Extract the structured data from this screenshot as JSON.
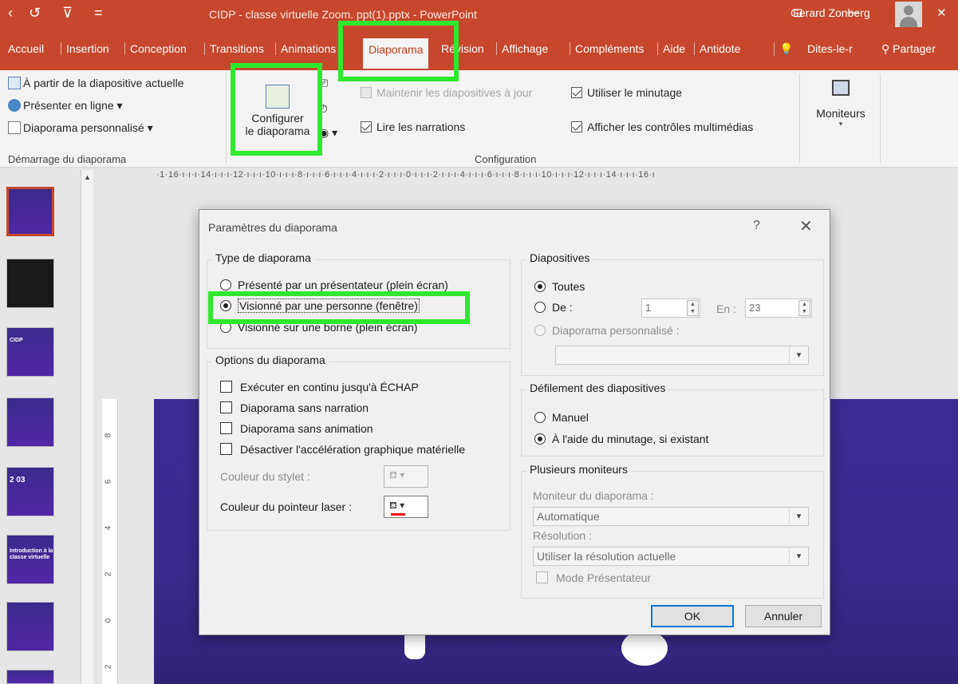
{
  "window": {
    "title": "CIDP - classe virtuelle Zoom. ppt(1).pptx  -  PowerPoint",
    "user": "Gerard Zonberg",
    "quick_access": [
      "‹",
      "↺",
      "⊽",
      "="
    ],
    "controls": [
      "⊡",
      "—",
      "☐",
      "✕"
    ]
  },
  "tabs": [
    "Accueil",
    "Insertion",
    "Conception",
    "Transitions",
    "Animations",
    "Diaporama",
    "Révision",
    "Affichage",
    "Compléments",
    "Aide",
    "Antidote",
    "💡",
    "Dites-le-r"
  ],
  "active_tab": "Diaporama",
  "share_label": "Partager",
  "ribbon": {
    "start_group": {
      "items": [
        "À partir de la diapositive actuelle",
        "Présenter en ligne  ▾",
        "Diaporama personnalisé ▾"
      ],
      "label": "Démarrage du diaporama"
    },
    "configure_button": {
      "line1": "Configurer",
      "line2": "le diaporama"
    },
    "options": {
      "keep_updated": "Maintenir les diapositives à jour",
      "read_narrations": "Lire les narrations",
      "use_timings": "Utiliser le minutage",
      "show_media_controls": "Afficher les contrôles multimédias"
    },
    "config_label": "Configuration",
    "monitors_label": "Moniteurs"
  },
  "ruler": {
    "horizontal": "·1·16·ı·ı·ı·14·ı·ı·ı·12·ı·ı·ı·10·ı·ı·ı·8·ı·ı·ı·6·ı·ı·ı·4·ı·ı·ı·2·ı·ı·ı·0·ı·ı·ı·2·ı·ı·ı·4·ı·ı·ı·6·ı·ı·ı·8·ı·ı·ı·10·ı·ı·ı·12·ı·ı·ı·14·ı·ı·ı·16·ı",
    "vertical": [
      "8",
      "6",
      "4",
      "2",
      "0",
      "2"
    ]
  },
  "thumbnails": [
    {
      "label": ""
    },
    {
      "label": ""
    },
    {
      "label": "CIDP"
    },
    {
      "label": ""
    },
    {
      "label": "2  03"
    },
    {
      "label": "Introduction à la classe virtuelle"
    },
    {
      "label": ""
    },
    {
      "label": ""
    }
  ],
  "dialog": {
    "title": "Paramètres du diaporama",
    "help": "?",
    "close": "✕",
    "show_type": {
      "title": "Type de diaporama",
      "options": [
        "Présenté par un présentateur (plein écran)",
        "Visionné par une personne (fenêtre)",
        "Visionné sur une borne (plein écran)"
      ],
      "selected": 1
    },
    "show_options": {
      "title": "Options du diaporama",
      "checks": [
        "Exécuter en continu jusqu'à ÉCHAP",
        "Diaporama sans narration",
        "Diaporama sans animation",
        "Désactiver l'accélération graphique matérielle"
      ],
      "pen_color_label": "Couleur du stylet :",
      "laser_color_label": "Couleur du pointeur laser :"
    },
    "slides": {
      "title": "Diapositives",
      "all": "Toutes",
      "from": "De :",
      "from_value": "1",
      "to": "En :",
      "to_value": "23",
      "custom": "Diaporama personnalisé :",
      "custom_value": ""
    },
    "advance": {
      "title": "Défilement des diapositives",
      "manual": "Manuel",
      "timings": "À l'aide du minutage, si existant"
    },
    "monitors": {
      "title": "Plusieurs moniteurs",
      "monitor_label": "Moniteur du diaporama :",
      "monitor_value": "Automatique",
      "resolution_label": "Résolution :",
      "resolution_value": "Utiliser la résolution actuelle",
      "presenter_mode": "Mode Présentateur"
    },
    "ok": "OK",
    "cancel": "Annuler"
  },
  "colors": {
    "brand": "#c7472c",
    "highlight": "#2ee82e",
    "slide": "#3d2b92"
  }
}
